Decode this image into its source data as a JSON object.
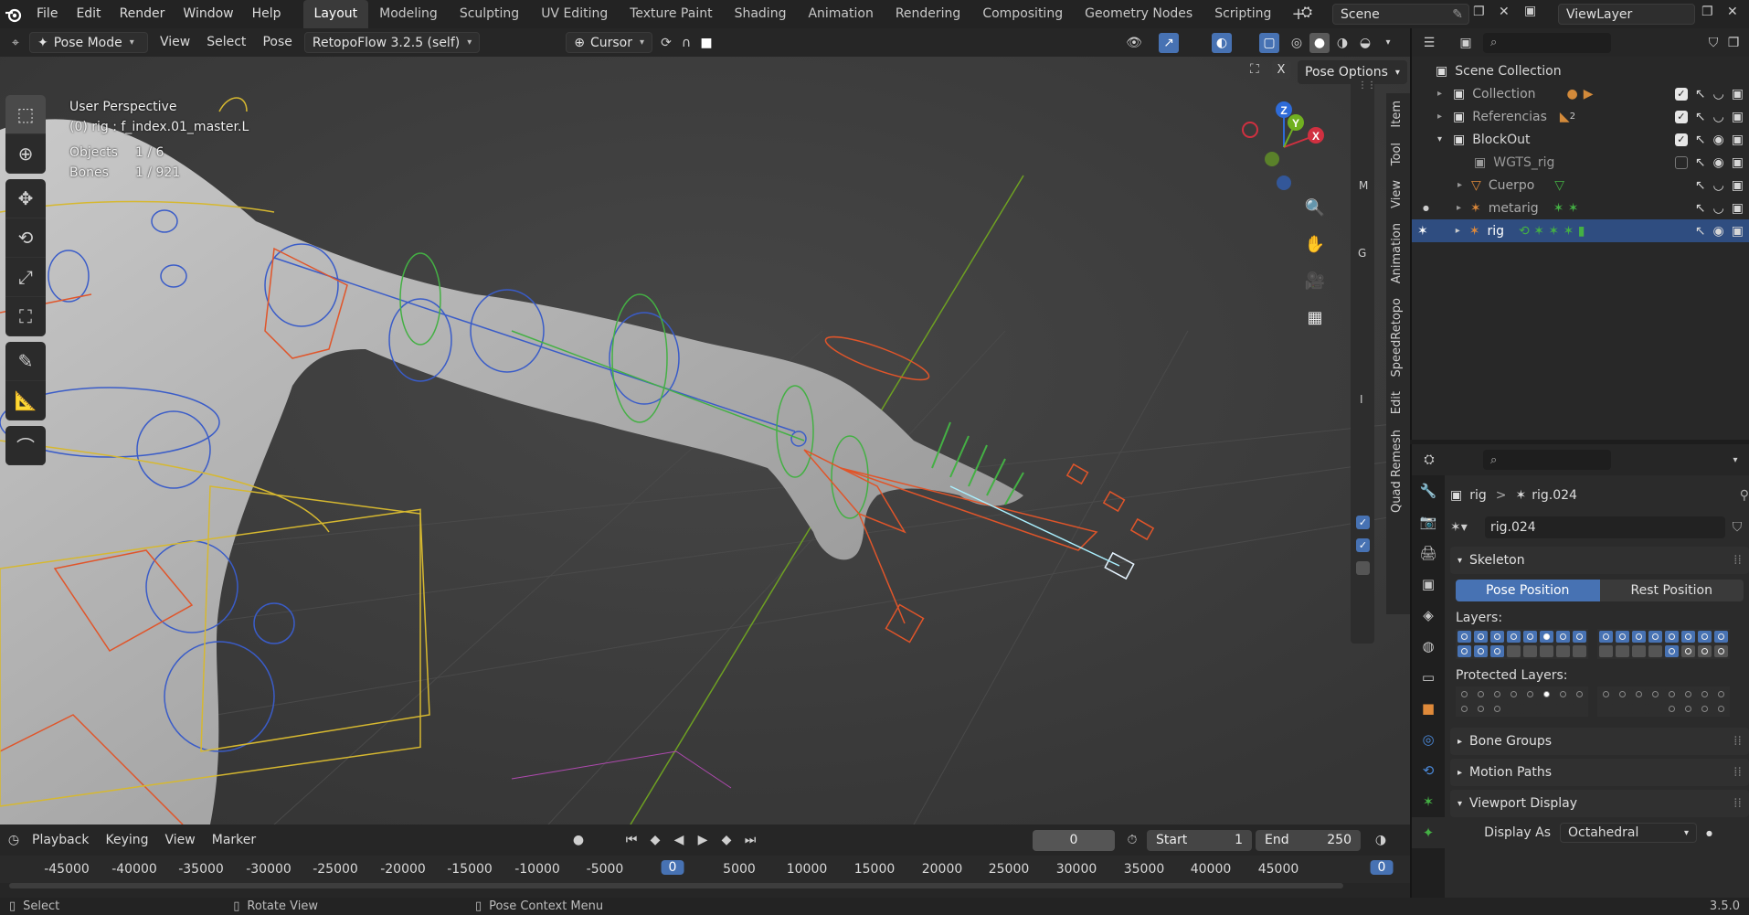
{
  "topbar": {
    "menus": [
      "File",
      "Edit",
      "Render",
      "Window",
      "Help"
    ],
    "workspaces": [
      "Layout",
      "Modeling",
      "Sculpting",
      "UV Editing",
      "Texture Paint",
      "Shading",
      "Animation",
      "Rendering",
      "Compositing",
      "Geometry Nodes",
      "Scripting"
    ],
    "active_workspace": "Layout",
    "add_workspace": "+",
    "scene": "Scene",
    "view_layer": "ViewLayer"
  },
  "viewport_header": {
    "mode": "Pose Mode",
    "menus": [
      "View",
      "Select",
      "Pose"
    ],
    "addon": "RetopoFlow 3.2.5 (self)",
    "pivot": "Cursor",
    "pose_options": "Pose Options",
    "close": "X"
  },
  "viewport_info": {
    "perspective": "User Perspective",
    "active": "(0) rig : f_index.01_master.L",
    "objects_label": "Objects",
    "objects_value": "1 / 6",
    "bones_label": "Bones",
    "bones_value": "1 / 921"
  },
  "gizmo": {
    "z": "Z",
    "y": "Y",
    "x": "X"
  },
  "side_tabs": [
    "Item",
    "Tool",
    "View",
    "Animation",
    "SpeedRetopo",
    "Edit",
    "Quad Remesh"
  ],
  "mini_labels": [
    "M",
    "G",
    "I"
  ],
  "timeline": {
    "menus": [
      "Playback",
      "Keying",
      "View",
      "Marker"
    ],
    "current_frame": "0",
    "start_label": "Start",
    "start_value": "1",
    "end_label": "End",
    "end_value": "250",
    "ticks": [
      "-45000",
      "-40000",
      "-35000",
      "-30000",
      "-25000",
      "-20000",
      "-15000",
      "-10000",
      "-5000",
      "0",
      "5000",
      "10000",
      "15000",
      "20000",
      "25000",
      "30000",
      "35000",
      "40000",
      "45000"
    ],
    "right_frame": "0"
  },
  "statusbar": {
    "select": "Select",
    "rotate": "Rotate View",
    "context": "Pose Context Menu",
    "version": "3.5.0"
  },
  "outliner": {
    "root": "Scene Collection",
    "rows": [
      {
        "name": "Collection"
      },
      {
        "name": "Referencias",
        "badge": "2"
      },
      {
        "name": "BlockOut"
      },
      {
        "name": "WGTS_rig"
      },
      {
        "name": "Cuerpo"
      },
      {
        "name": "metarig"
      },
      {
        "name": "rig"
      }
    ]
  },
  "properties": {
    "breadcrumb_obj": "rig",
    "breadcrumb_sep": ">",
    "breadcrumb_data": "rig.024",
    "data_name": "rig.024",
    "skeleton": "Skeleton",
    "pose_position": "Pose Position",
    "rest_position": "Rest Position",
    "layers": "Layers:",
    "protected_layers": "Protected Layers:",
    "bone_groups": "Bone Groups",
    "motion_paths": "Motion Paths",
    "viewport_display": "Viewport Display",
    "display_as_label": "Display As",
    "display_as_value": "Octahedral"
  },
  "colors": {
    "accent": "#4772b3",
    "selected_row": "#2f4d80",
    "bone_orange": "#e0552a",
    "bone_green": "#44b044",
    "bone_blue": "#3a5cc8",
    "bone_yellow": "#d6b830"
  }
}
